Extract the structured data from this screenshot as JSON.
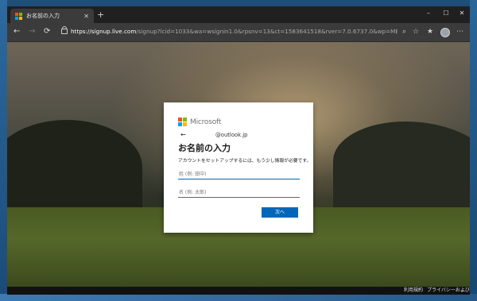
{
  "browser": {
    "tab": {
      "title": "お名前の入力",
      "close_glyph": "✕"
    },
    "new_tab_glyph": "+",
    "window_controls": {
      "minimize": "–",
      "maximize": "☐",
      "close": "✕"
    },
    "nav": {
      "back": "←",
      "forward": "→",
      "refresh": "⟳"
    },
    "url": {
      "host": "https://signup.live.com",
      "rest": "/signup?lcid=1033&wa=wsignin1.0&rpsnv=13&ct=1583641518&rver=7.0.6737.0&wp=MBI_SSL&wreply=htt..."
    },
    "toolbar_icons": [
      "read-aloud-icon",
      "add-favorite-icon",
      "favorites-icon",
      "collections-icon",
      "profile-avatar-icon",
      "more-icon"
    ]
  },
  "signin_card": {
    "brand": "Microsoft",
    "back_arrow": "←",
    "email": "@outlook.jp",
    "heading": "お名前の入力",
    "description": "アカウントをセットアップするには、もう少し情報が必要です。",
    "last_name_placeholder": "姓 (例: 田中)",
    "first_name_placeholder": "名 (例: 太郎)",
    "next_button": "次へ"
  },
  "footer": {
    "terms": "利用規約",
    "privacy": "プライバシーおよびクッキー",
    "more": "..."
  },
  "colors": {
    "ms_red": "#f25022",
    "ms_green": "#7fba00",
    "ms_blue": "#00a4ef",
    "ms_yellow": "#ffb900",
    "primary_button": "#0067b8",
    "browser_chrome": "#3b3b3b"
  }
}
